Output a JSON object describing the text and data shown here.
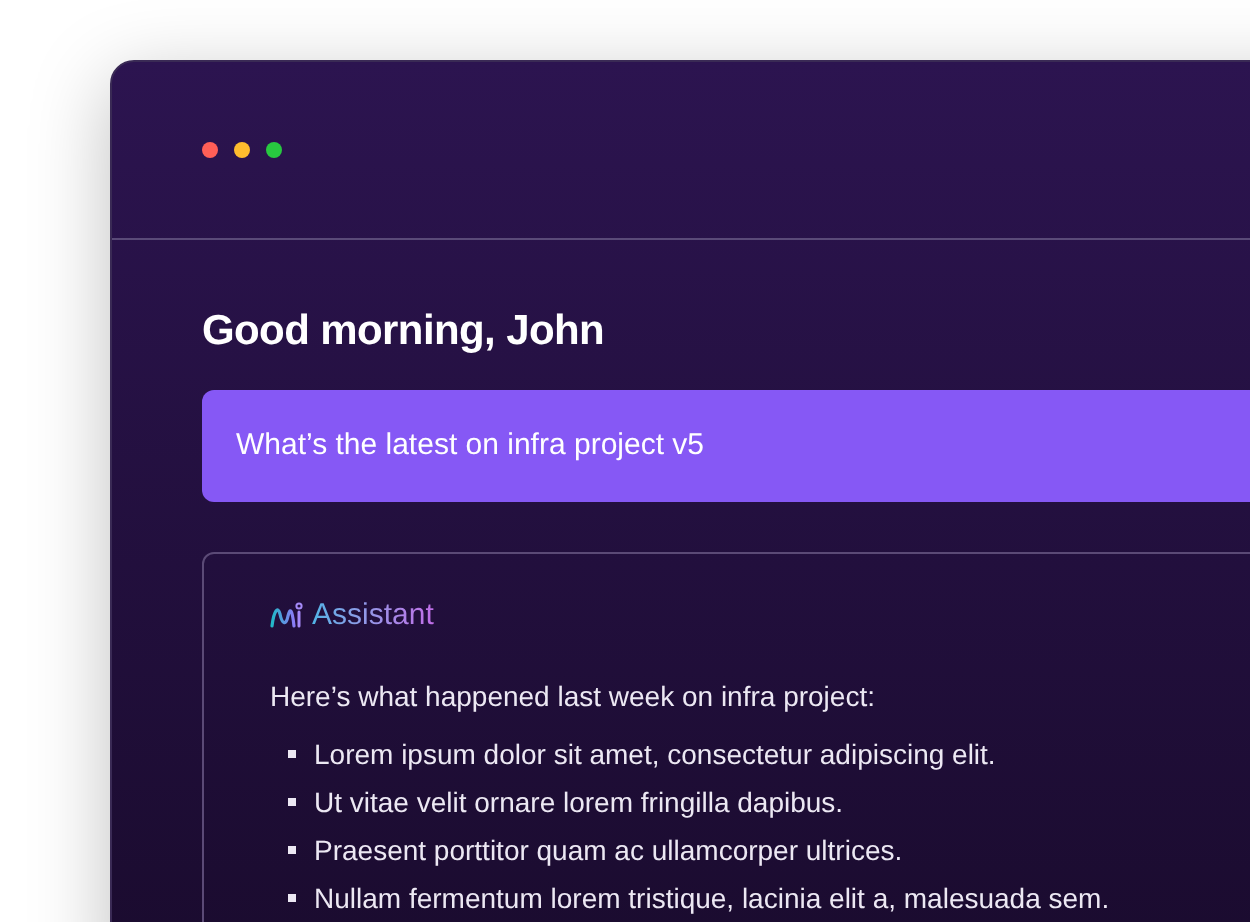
{
  "greeting": "Good morning, John",
  "prompt": {
    "value": "What’s the latest on infra project v5"
  },
  "response": {
    "author": "Assistant",
    "intro": "Here’s what happened last week on infra project:",
    "bullets": [
      "Lorem ipsum dolor sit amet, consectetur adipiscing elit.",
      "Ut vitae velit ornare lorem fringilla dapibus.",
      "Praesent porttitor quam ac ullamcorper ultrices.",
      "Nullam fermentum lorem tristique, lacinia elit a, malesuada sem."
    ]
  }
}
